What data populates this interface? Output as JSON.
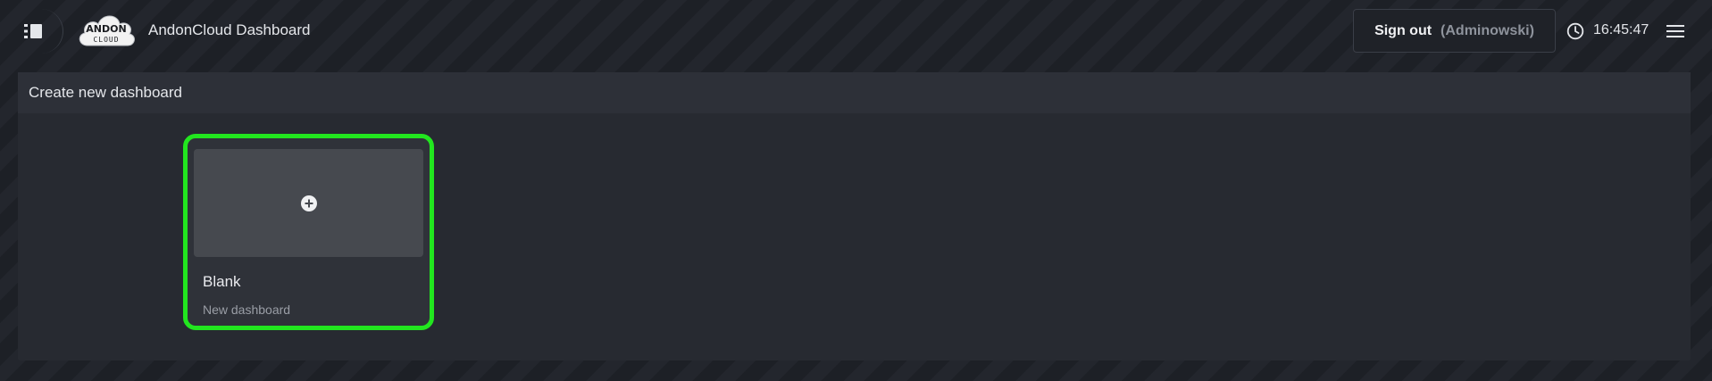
{
  "header": {
    "app_title": "AndonCloud Dashboard",
    "logo_text_top": "ANDON",
    "logo_text_bottom": "CLOUD",
    "signout_label": "Sign out",
    "signout_user": "(Adminowski)",
    "clock": "16:45:47",
    "icons": {
      "sidebar_toggle": "sidebar-list-icon",
      "clock": "clock-icon",
      "menu": "hamburger-menu-icon"
    }
  },
  "panel": {
    "title": "Create new dashboard",
    "templates": [
      {
        "title": "Blank",
        "subtitle": "New dashboard",
        "icon": "plus-circle-icon"
      }
    ]
  },
  "colors": {
    "highlight": "#22e61f",
    "panel_bg": "#272a31",
    "preview_bg": "#46494f"
  }
}
